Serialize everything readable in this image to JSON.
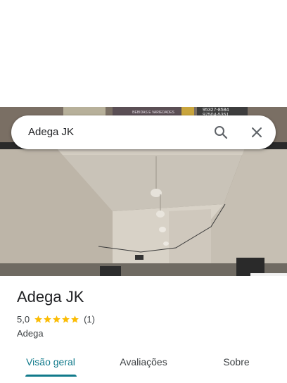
{
  "search": {
    "query": "Adega JK",
    "search_icon": "search-icon",
    "close_icon": "close-icon"
  },
  "photo": {
    "sign_text_center": "BEBIDAS E VARIEDADES",
    "sign_phone_1": "95327-8584",
    "sign_phone_2": "97504-5351"
  },
  "place": {
    "title": "Adega JK",
    "rating": "5,0",
    "stars": 5,
    "review_count": "(1)",
    "category": "Adega"
  },
  "tabs": [
    {
      "label": "Visão geral",
      "active": true
    },
    {
      "label": "Avaliações",
      "active": false
    },
    {
      "label": "Sobre",
      "active": false
    }
  ],
  "colors": {
    "accent": "#117a8b",
    "star": "#fbbc04"
  }
}
